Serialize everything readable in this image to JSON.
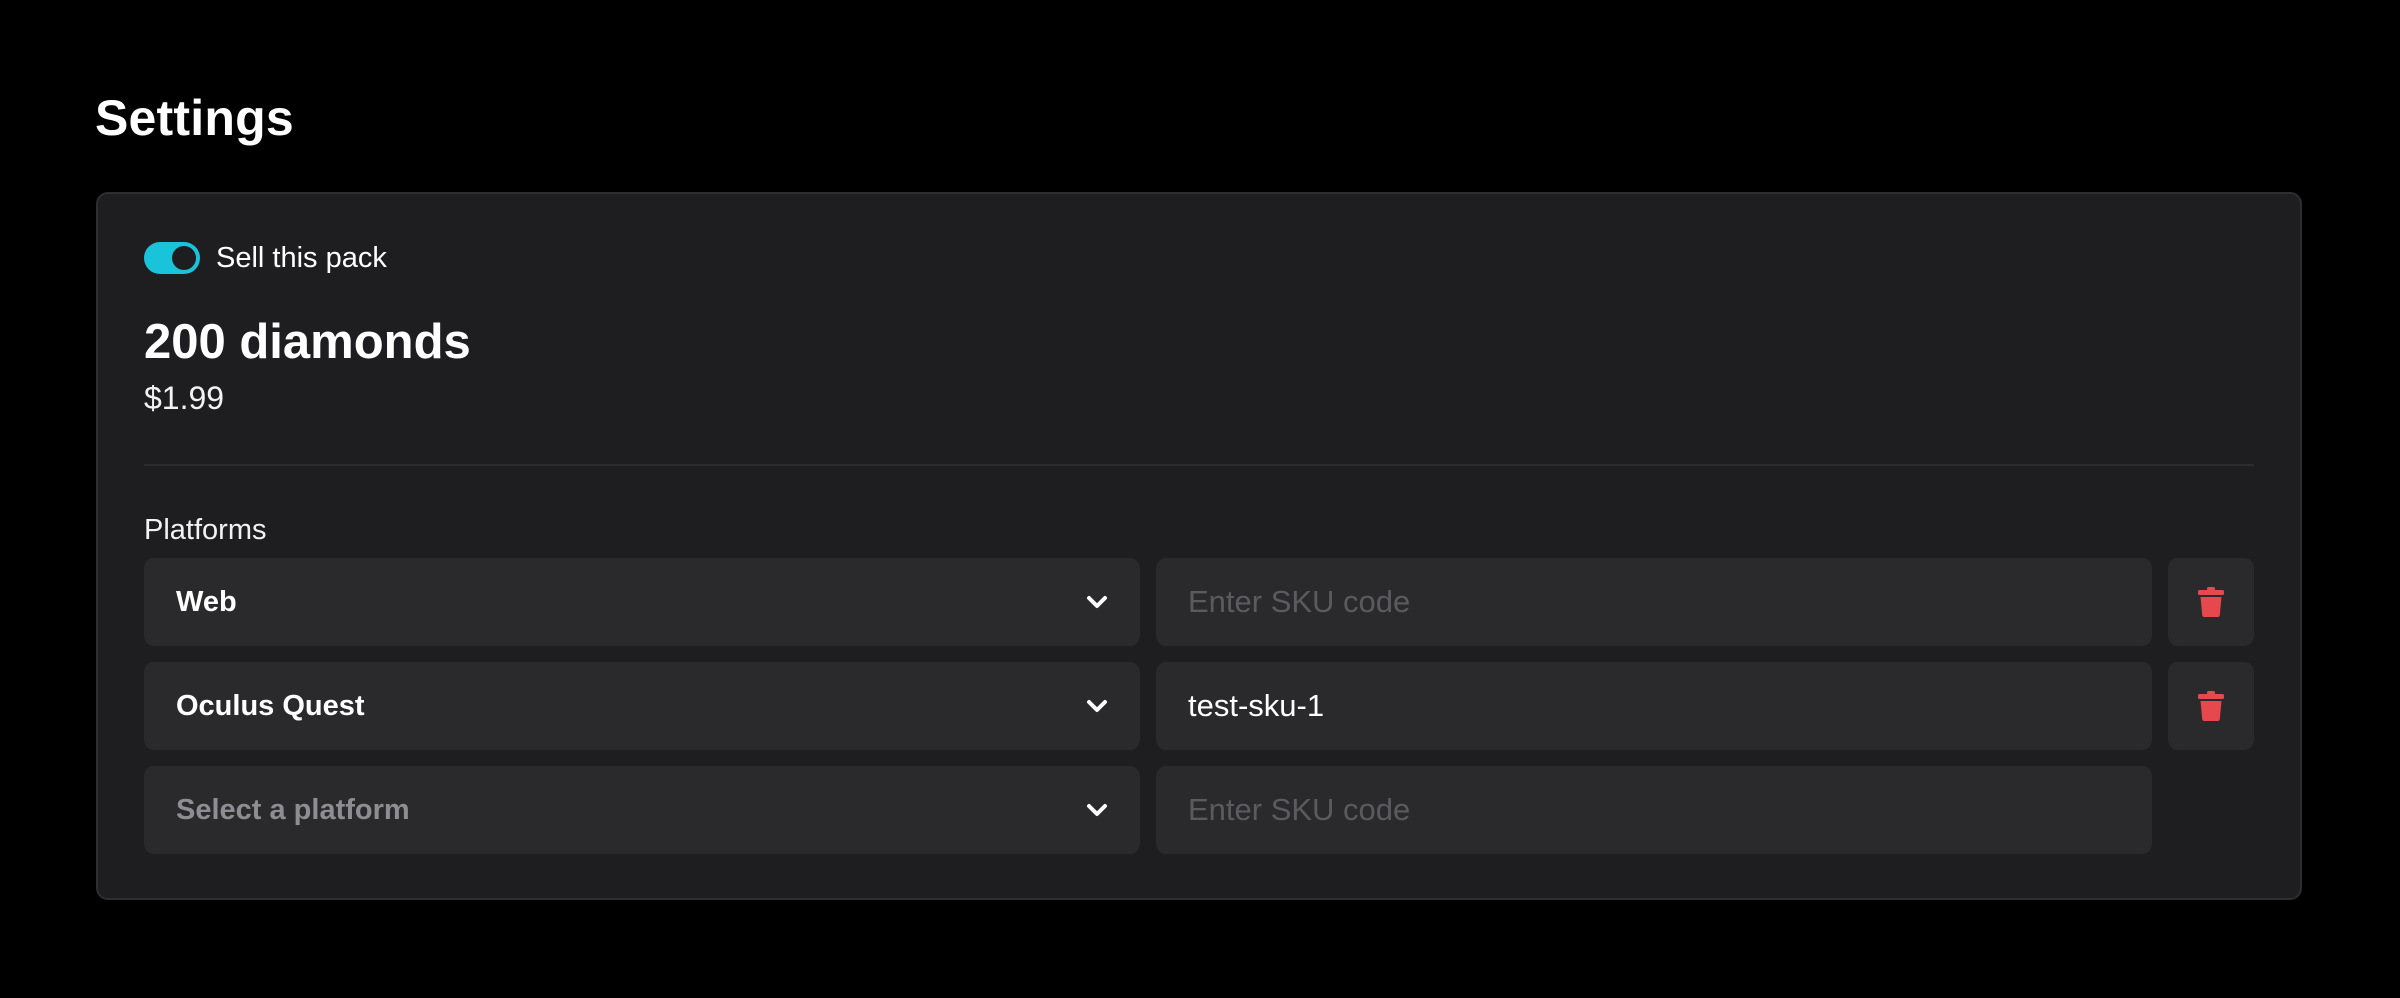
{
  "page": {
    "title": "Settings"
  },
  "pack": {
    "sell_toggle": {
      "label": "Sell this pack",
      "enabled": true
    },
    "name": "200 diamonds",
    "price": "$1.99"
  },
  "platforms": {
    "label": "Platforms",
    "rows": [
      {
        "platform": "Web",
        "is_placeholder": false,
        "sku_value": "",
        "sku_placeholder": "Enter SKU code",
        "deletable": true
      },
      {
        "platform": "Oculus Quest",
        "is_placeholder": false,
        "sku_value": "test-sku-1",
        "sku_placeholder": "Enter SKU code",
        "deletable": true
      },
      {
        "platform": "Select a platform",
        "is_placeholder": true,
        "sku_value": "",
        "sku_placeholder": "Enter SKU code",
        "deletable": false
      }
    ]
  },
  "icons": {
    "dropdown": "chevron-down-icon",
    "delete": "trash-icon"
  },
  "colors": {
    "background": "#000000",
    "card": "#1e1e20",
    "field": "#2a2a2d",
    "toggle_on": "#19c3d9",
    "delete": "#e5484d"
  }
}
